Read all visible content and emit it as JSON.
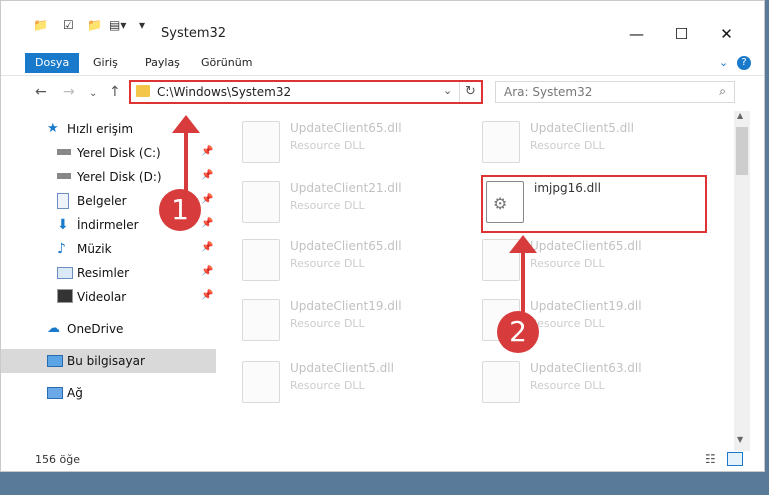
{
  "window": {
    "title": "System32",
    "controls": {
      "minimize": "—",
      "maximize": "☐",
      "close": "✕"
    }
  },
  "ribbon": {
    "tabs": [
      "Dosya",
      "Giriş",
      "Paylaş",
      "Görünüm"
    ],
    "help": "?"
  },
  "nav": {
    "address": "C:\\Windows\\System32",
    "search_placeholder": "Ara: System32"
  },
  "sidebar": {
    "items": [
      {
        "label": "Hızlı erişim",
        "icon": "star-icon"
      },
      {
        "label": "Yerel Disk (C:)",
        "icon": "drive-icon",
        "pinned": true
      },
      {
        "label": "Yerel Disk (D:)",
        "icon": "drive-icon",
        "pinned": true
      },
      {
        "label": "Belgeler",
        "icon": "documents-icon",
        "pinned": true
      },
      {
        "label": "İndirmeler",
        "icon": "download-icon",
        "pinned": true
      },
      {
        "label": "Müzik",
        "icon": "music-icon",
        "pinned": true
      },
      {
        "label": "Resimler",
        "icon": "pictures-icon",
        "pinned": true
      },
      {
        "label": "Videolar",
        "icon": "videos-icon",
        "pinned": true
      },
      {
        "label": "OneDrive",
        "icon": "cloud-icon"
      },
      {
        "label": "Bu bilgisayar",
        "icon": "computer-icon"
      },
      {
        "label": "Ağ",
        "icon": "network-icon"
      }
    ]
  },
  "files": [
    {
      "name": "UpdateClient65.dll",
      "type": "Resource DLL"
    },
    {
      "name": "UpdateClient5.dll",
      "type": "Resource DLL"
    },
    {
      "name": "UpdateClient21.dll",
      "type": "Resource DLL"
    },
    {
      "name": "imjpg16.dll",
      "type": ""
    },
    {
      "name": "UpdateClient65.dll",
      "type": "Resource DLL"
    },
    {
      "name": "UpdateClient65.dll",
      "type": "Resource DLL"
    },
    {
      "name": "UpdateClient19.dll",
      "type": "Resource DLL"
    },
    {
      "name": "UpdateClient19.dll",
      "type": "Resource DLL"
    },
    {
      "name": "UpdateClient5.dll",
      "type": "Resource DLL"
    },
    {
      "name": "UpdateClient63.dll",
      "type": "Resource DLL"
    }
  ],
  "status": {
    "count": "156 öğe"
  },
  "callouts": {
    "one": "1",
    "two": "2"
  },
  "colors": {
    "accent": "#1979ca",
    "highlight": "#d83b3b"
  }
}
